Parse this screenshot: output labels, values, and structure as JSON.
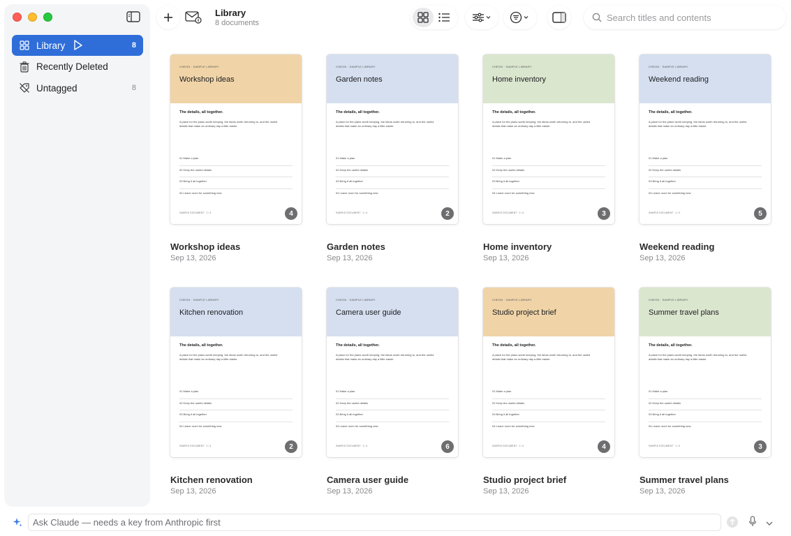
{
  "sidebar": {
    "items": [
      {
        "label": "Library",
        "count": "8",
        "icon": "grid-icon",
        "active": true
      },
      {
        "label": "Recently Deleted",
        "count": "",
        "icon": "trash-icon",
        "active": false
      },
      {
        "label": "Untagged",
        "count": "8",
        "icon": "untag-icon",
        "active": false
      }
    ]
  },
  "header": {
    "title": "Library",
    "subtitle": "8 documents"
  },
  "search": {
    "placeholder": "Search titles and contents"
  },
  "thumbnail": {
    "kicker": "CHEON · SAMPLE LIBRARY",
    "heading": "The details, all together.",
    "paragraph": "A place for the plans worth keeping, the ideas worth returning to, and the useful details that make an ordinary day a little easier.",
    "list": [
      "01   Make a plan",
      "02   Keep the useful details",
      "03   Bring it all together",
      "04   Leave room for something new"
    ],
    "footer": "SAMPLE DOCUMENT  ·  1 / 4"
  },
  "documents": [
    {
      "title": "Workshop ideas",
      "date": "Sep 13, 2026",
      "pages": "4",
      "color": "#f0d4a8"
    },
    {
      "title": "Garden notes",
      "date": "Sep 13, 2026",
      "pages": "2",
      "color": "#d5dff0"
    },
    {
      "title": "Home inventory",
      "date": "Sep 13, 2026",
      "pages": "3",
      "color": "#dbe6cf"
    },
    {
      "title": "Weekend reading",
      "date": "Sep 13, 2026",
      "pages": "5",
      "color": "#d5dff0"
    },
    {
      "title": "Kitchen renovation",
      "date": "Sep 13, 2026",
      "pages": "2",
      "color": "#d5dff0"
    },
    {
      "title": "Camera user guide",
      "date": "Sep 13, 2026",
      "pages": "6",
      "color": "#d5dff0"
    },
    {
      "title": "Studio project brief",
      "date": "Sep 13, 2026",
      "pages": "4",
      "color": "#f0d4a8"
    },
    {
      "title": "Summer travel plans",
      "date": "Sep 13, 2026",
      "pages": "3",
      "color": "#dbe6cf"
    }
  ],
  "ask": {
    "placeholder": "Ask Claude — needs a key from Anthropic first"
  },
  "colors": {
    "accent": "#2f6ed9",
    "sidebar_bg": "#f4f5f7"
  }
}
